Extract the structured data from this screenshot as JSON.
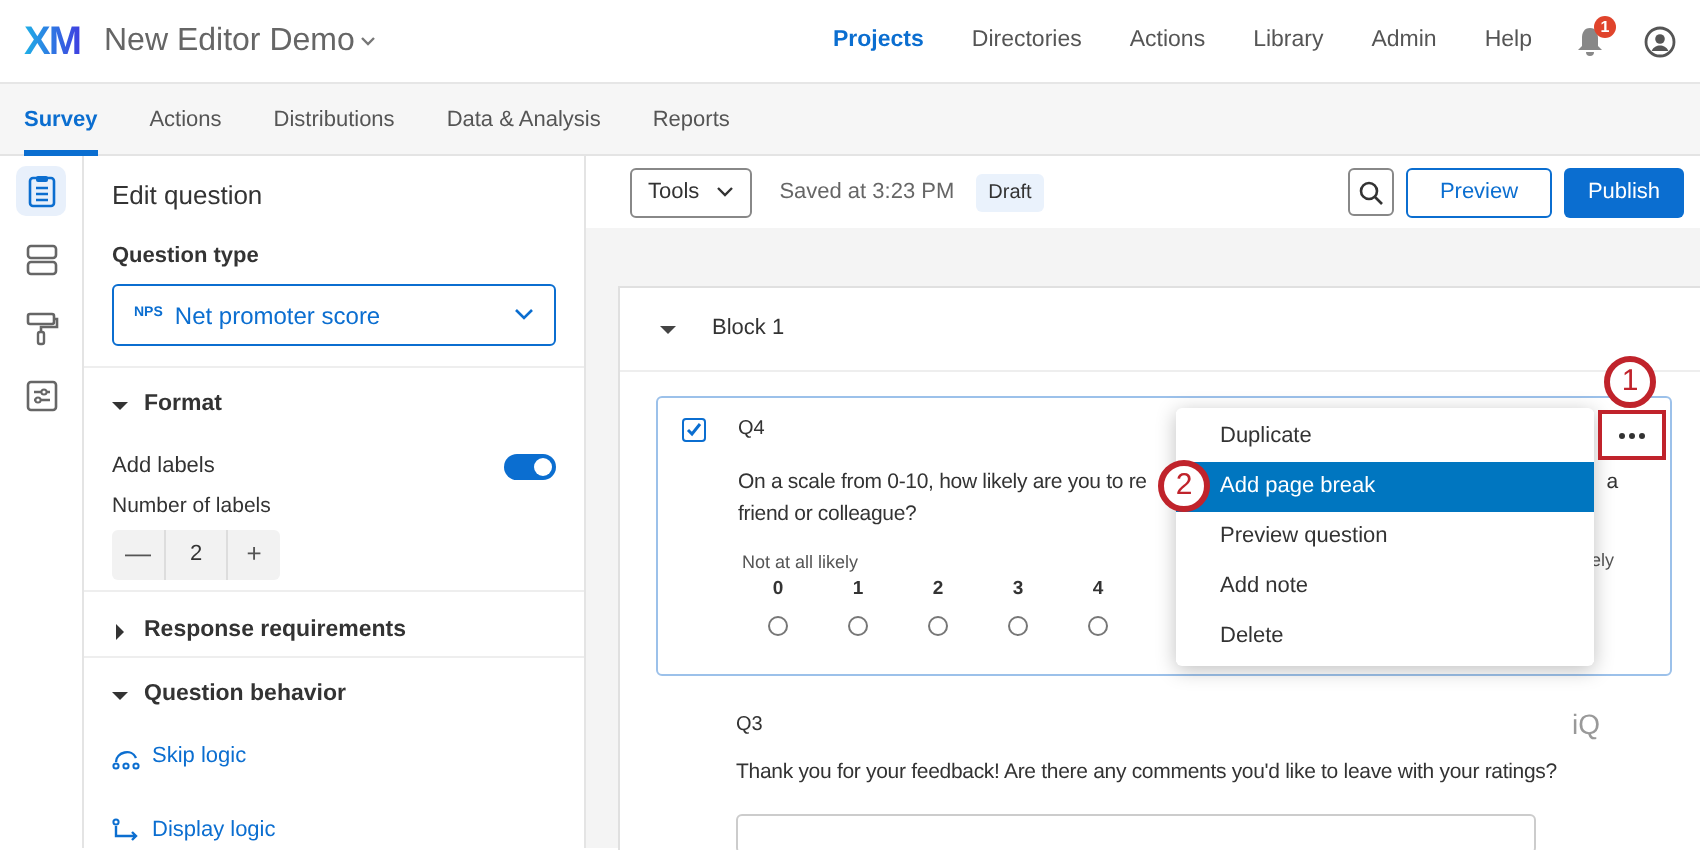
{
  "header": {
    "logo": "XM",
    "project_title": "New Editor Demo",
    "nav": [
      {
        "label": "Projects",
        "selected": true
      },
      {
        "label": "Directories",
        "selected": false
      },
      {
        "label": "Actions",
        "selected": false
      },
      {
        "label": "Library",
        "selected": false
      },
      {
        "label": "Admin",
        "selected": false
      },
      {
        "label": "Help",
        "selected": false
      }
    ],
    "notification_count": "1"
  },
  "tabs": [
    {
      "label": "Survey",
      "selected": true
    },
    {
      "label": "Actions",
      "selected": false
    },
    {
      "label": "Distributions",
      "selected": false
    },
    {
      "label": "Data & Analysis",
      "selected": false
    },
    {
      "label": "Reports",
      "selected": false
    }
  ],
  "rail": [
    {
      "kind": "survey",
      "selected": true
    },
    {
      "kind": "blocks",
      "selected": false
    },
    {
      "kind": "look",
      "selected": false
    },
    {
      "kind": "options",
      "selected": false
    }
  ],
  "edit_panel": {
    "title": "Edit question",
    "question_type_label": "Question type",
    "question_type": {
      "badge": "NPS",
      "value": "Net promoter score"
    },
    "format": {
      "title": "Format",
      "expanded": true,
      "add_labels": {
        "label": "Add labels",
        "on": true
      },
      "number_of_labels": {
        "label": "Number of labels",
        "value": "2",
        "decrement": "—",
        "increment": "+"
      }
    },
    "response_requirements": {
      "title": "Response requirements",
      "expanded": false
    },
    "question_behavior": {
      "title": "Question behavior",
      "expanded": true,
      "links": [
        {
          "kind": "skip",
          "label": "Skip logic"
        },
        {
          "kind": "display",
          "label": "Display logic"
        }
      ]
    }
  },
  "toolbar": {
    "tools": "Tools",
    "saved": "Saved at 3:23 PM",
    "status": "Draft",
    "preview": "Preview",
    "publish": "Publish"
  },
  "block": {
    "title": "Block 1",
    "expanded": true
  },
  "question": {
    "number": "Q4",
    "checked": true,
    "text_start": "On a scale from 0-10, how likely are you to re",
    "text_end": "a",
    "text_line2": "friend or colleague?",
    "scale_low": "Not at all likely",
    "scale_high": "ely",
    "points": [
      {
        "label": "0",
        "selected": false
      },
      {
        "label": "1",
        "selected": false
      },
      {
        "label": "2",
        "selected": false
      },
      {
        "label": "3",
        "selected": false
      },
      {
        "label": "4",
        "selected": false
      }
    ]
  },
  "menu": {
    "items": [
      {
        "label": "Duplicate",
        "selected": false
      },
      {
        "label": "Add page break",
        "selected": true
      },
      {
        "label": "Preview question",
        "selected": false
      },
      {
        "label": "Add note",
        "selected": false
      },
      {
        "label": "Delete",
        "selected": false
      }
    ],
    "callouts": [
      "1",
      "2"
    ]
  },
  "question2": {
    "number": "Q3",
    "badge": "iQ",
    "text": "Thank you for your feedback! Are there any comments you'd like to leave with your ratings?"
  }
}
